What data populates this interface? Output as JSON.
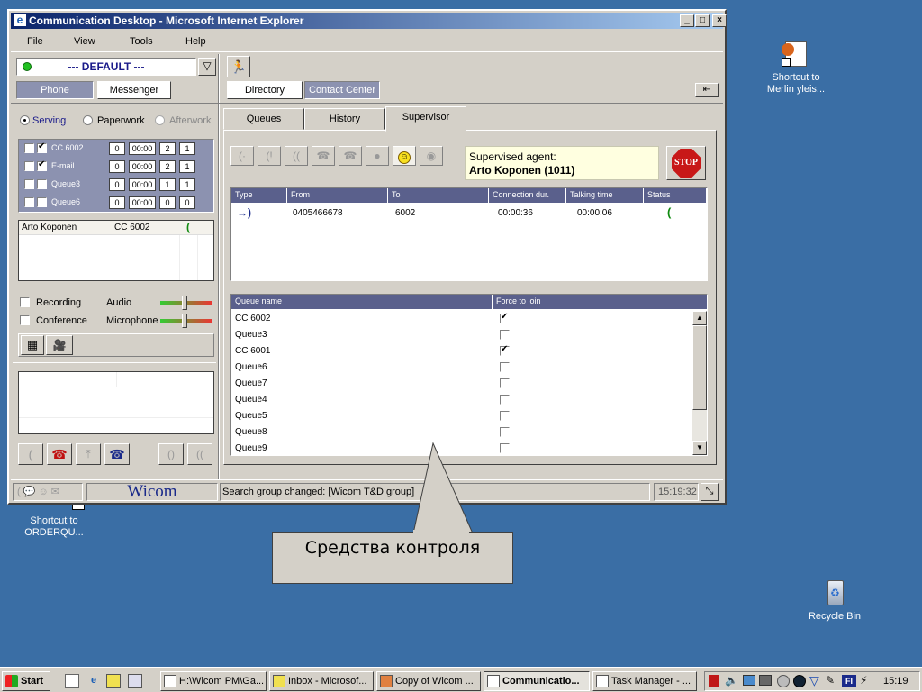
{
  "window": {
    "title": "Communication Desktop - Microsoft Internet Explorer"
  },
  "menu": [
    "File",
    "View",
    "Tools",
    "Help"
  ],
  "profile": {
    "selected": "--- DEFAULT ---"
  },
  "left_tabs": {
    "phone": "Phone",
    "messenger": "Messenger"
  },
  "right_tabs": {
    "directory": "Directory",
    "contact_center": "Contact Center"
  },
  "states": {
    "serving": "Serving",
    "paperwork": "Paperwork",
    "afterwork": "Afterwork",
    "selected": "Serving"
  },
  "queues": [
    {
      "name": "CC 6002",
      "checked": true,
      "a": "0",
      "time": "00:00",
      "b": "2",
      "c": "1"
    },
    {
      "name": "E-mail",
      "checked": true,
      "a": "0",
      "time": "00:00",
      "b": "2",
      "c": "1"
    },
    {
      "name": "Queue3",
      "checked": false,
      "a": "0",
      "time": "00:00",
      "b": "1",
      "c": "1"
    },
    {
      "name": "Queue6",
      "checked": false,
      "a": "0",
      "time": "00:00",
      "b": "0",
      "c": "0"
    }
  ],
  "active_call": {
    "agent": "Arto Koponen",
    "queue": "CC 6002"
  },
  "audio_controls": {
    "recording": "Recording",
    "conference": "Conference",
    "audio": "Audio",
    "microphone": "Microphone"
  },
  "status_bar": {
    "brand": "Wicom",
    "message": "Search group changed: [Wicom T&D group]",
    "time": "15:19:32"
  },
  "sub_tabs": {
    "queues": "Queues",
    "history": "History",
    "supervisor": "Supervisor",
    "active": "Supervisor"
  },
  "supervised": {
    "label": "Supervised agent:",
    "agent": "Arto Koponen (1011)",
    "stop": "STOP"
  },
  "calls_table": {
    "headers": [
      "Type",
      "From",
      "To",
      "Connection dur.",
      "Talking time",
      "Status"
    ],
    "rows": [
      {
        "from": "0405466678",
        "to": "6002",
        "connection": "00:00:36",
        "talking": "00:00:06"
      }
    ]
  },
  "queue_table": {
    "headers": [
      "Queue name",
      "Force to join"
    ],
    "rows": [
      {
        "name": "CC 6002",
        "force": true
      },
      {
        "name": "Queue3",
        "force": false
      },
      {
        "name": "CC 6001",
        "force": true
      },
      {
        "name": "Queue6",
        "force": false
      },
      {
        "name": "Queue7",
        "force": false
      },
      {
        "name": "Queue4",
        "force": false
      },
      {
        "name": "Queue5",
        "force": false
      },
      {
        "name": "Queue8",
        "force": false
      },
      {
        "name": "Queue9",
        "force": false
      }
    ]
  },
  "callout": {
    "text": "Средства контроля"
  },
  "desktop_icons": {
    "merlin": [
      "Shortcut to",
      "Merlin yleis..."
    ],
    "orderqu": [
      "Shortcut to",
      "ORDERQU..."
    ],
    "recycle": "Recycle Bin"
  },
  "taskbar": {
    "start": "Start",
    "tasks": [
      "H:\\Wicom PM\\Ga...",
      "Inbox - Microsof...",
      "Copy of Wicom ...",
      "Communicatio...",
      "Task Manager - ..."
    ],
    "active_task": "Communicatio...",
    "tray_lang": "FI",
    "clock": "15:19"
  },
  "colors": {
    "desktop": "#3a6ea5",
    "title_active": "#0a246a",
    "header": "#5a608c",
    "queue_row": "#8c92b0",
    "tooltip_bg": "#ffffe0"
  }
}
